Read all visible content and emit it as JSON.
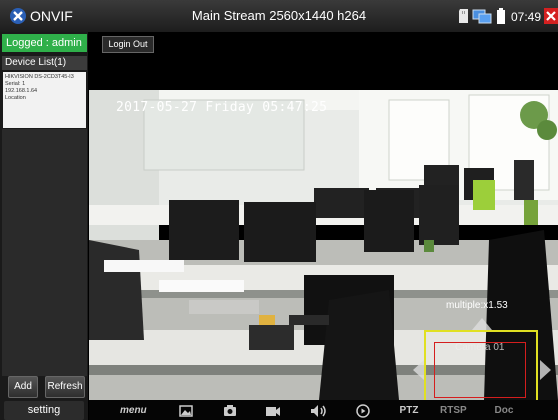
{
  "titlebar": {
    "app_name": "ONVIF",
    "stream_title": "Main Stream 2560x1440 h264",
    "time": "07:49",
    "icons": [
      "onvif-logo-icon",
      "sd-card-icon",
      "network-icon",
      "battery-icon",
      "close-icon"
    ],
    "close_color": "#d42020"
  },
  "sidebar": {
    "logged_text": "Logged : admin",
    "logged_color": "#2fb04a",
    "device_list_label": "Device List(1)",
    "devices": [
      {
        "model": "HIKVISION DS-2CD3T45-I3",
        "serial": "Serial: 1",
        "ip": "192.168.1.64",
        "location": "Location"
      }
    ],
    "add_label": "Add",
    "refresh_label": "Refresh",
    "setting_label": "setting"
  },
  "header": {
    "login_out_label": "Login Out"
  },
  "video": {
    "osd_time": "2017-05-27 Friday 05:47:25",
    "zoom_text": "multiple:x1.53",
    "camera_label": "Camera 01",
    "ptz_frame_color": "#e0e022",
    "ptz_inner_color": "#d41e1e"
  },
  "toolbar": {
    "menu_label": "menu",
    "ptz_label": "PTZ",
    "rtsp_label": "RTSP",
    "doc_label": "Doc",
    "icons": [
      "image-icon",
      "camera-icon",
      "video-record-icon",
      "speaker-icon",
      "play-icon"
    ]
  }
}
